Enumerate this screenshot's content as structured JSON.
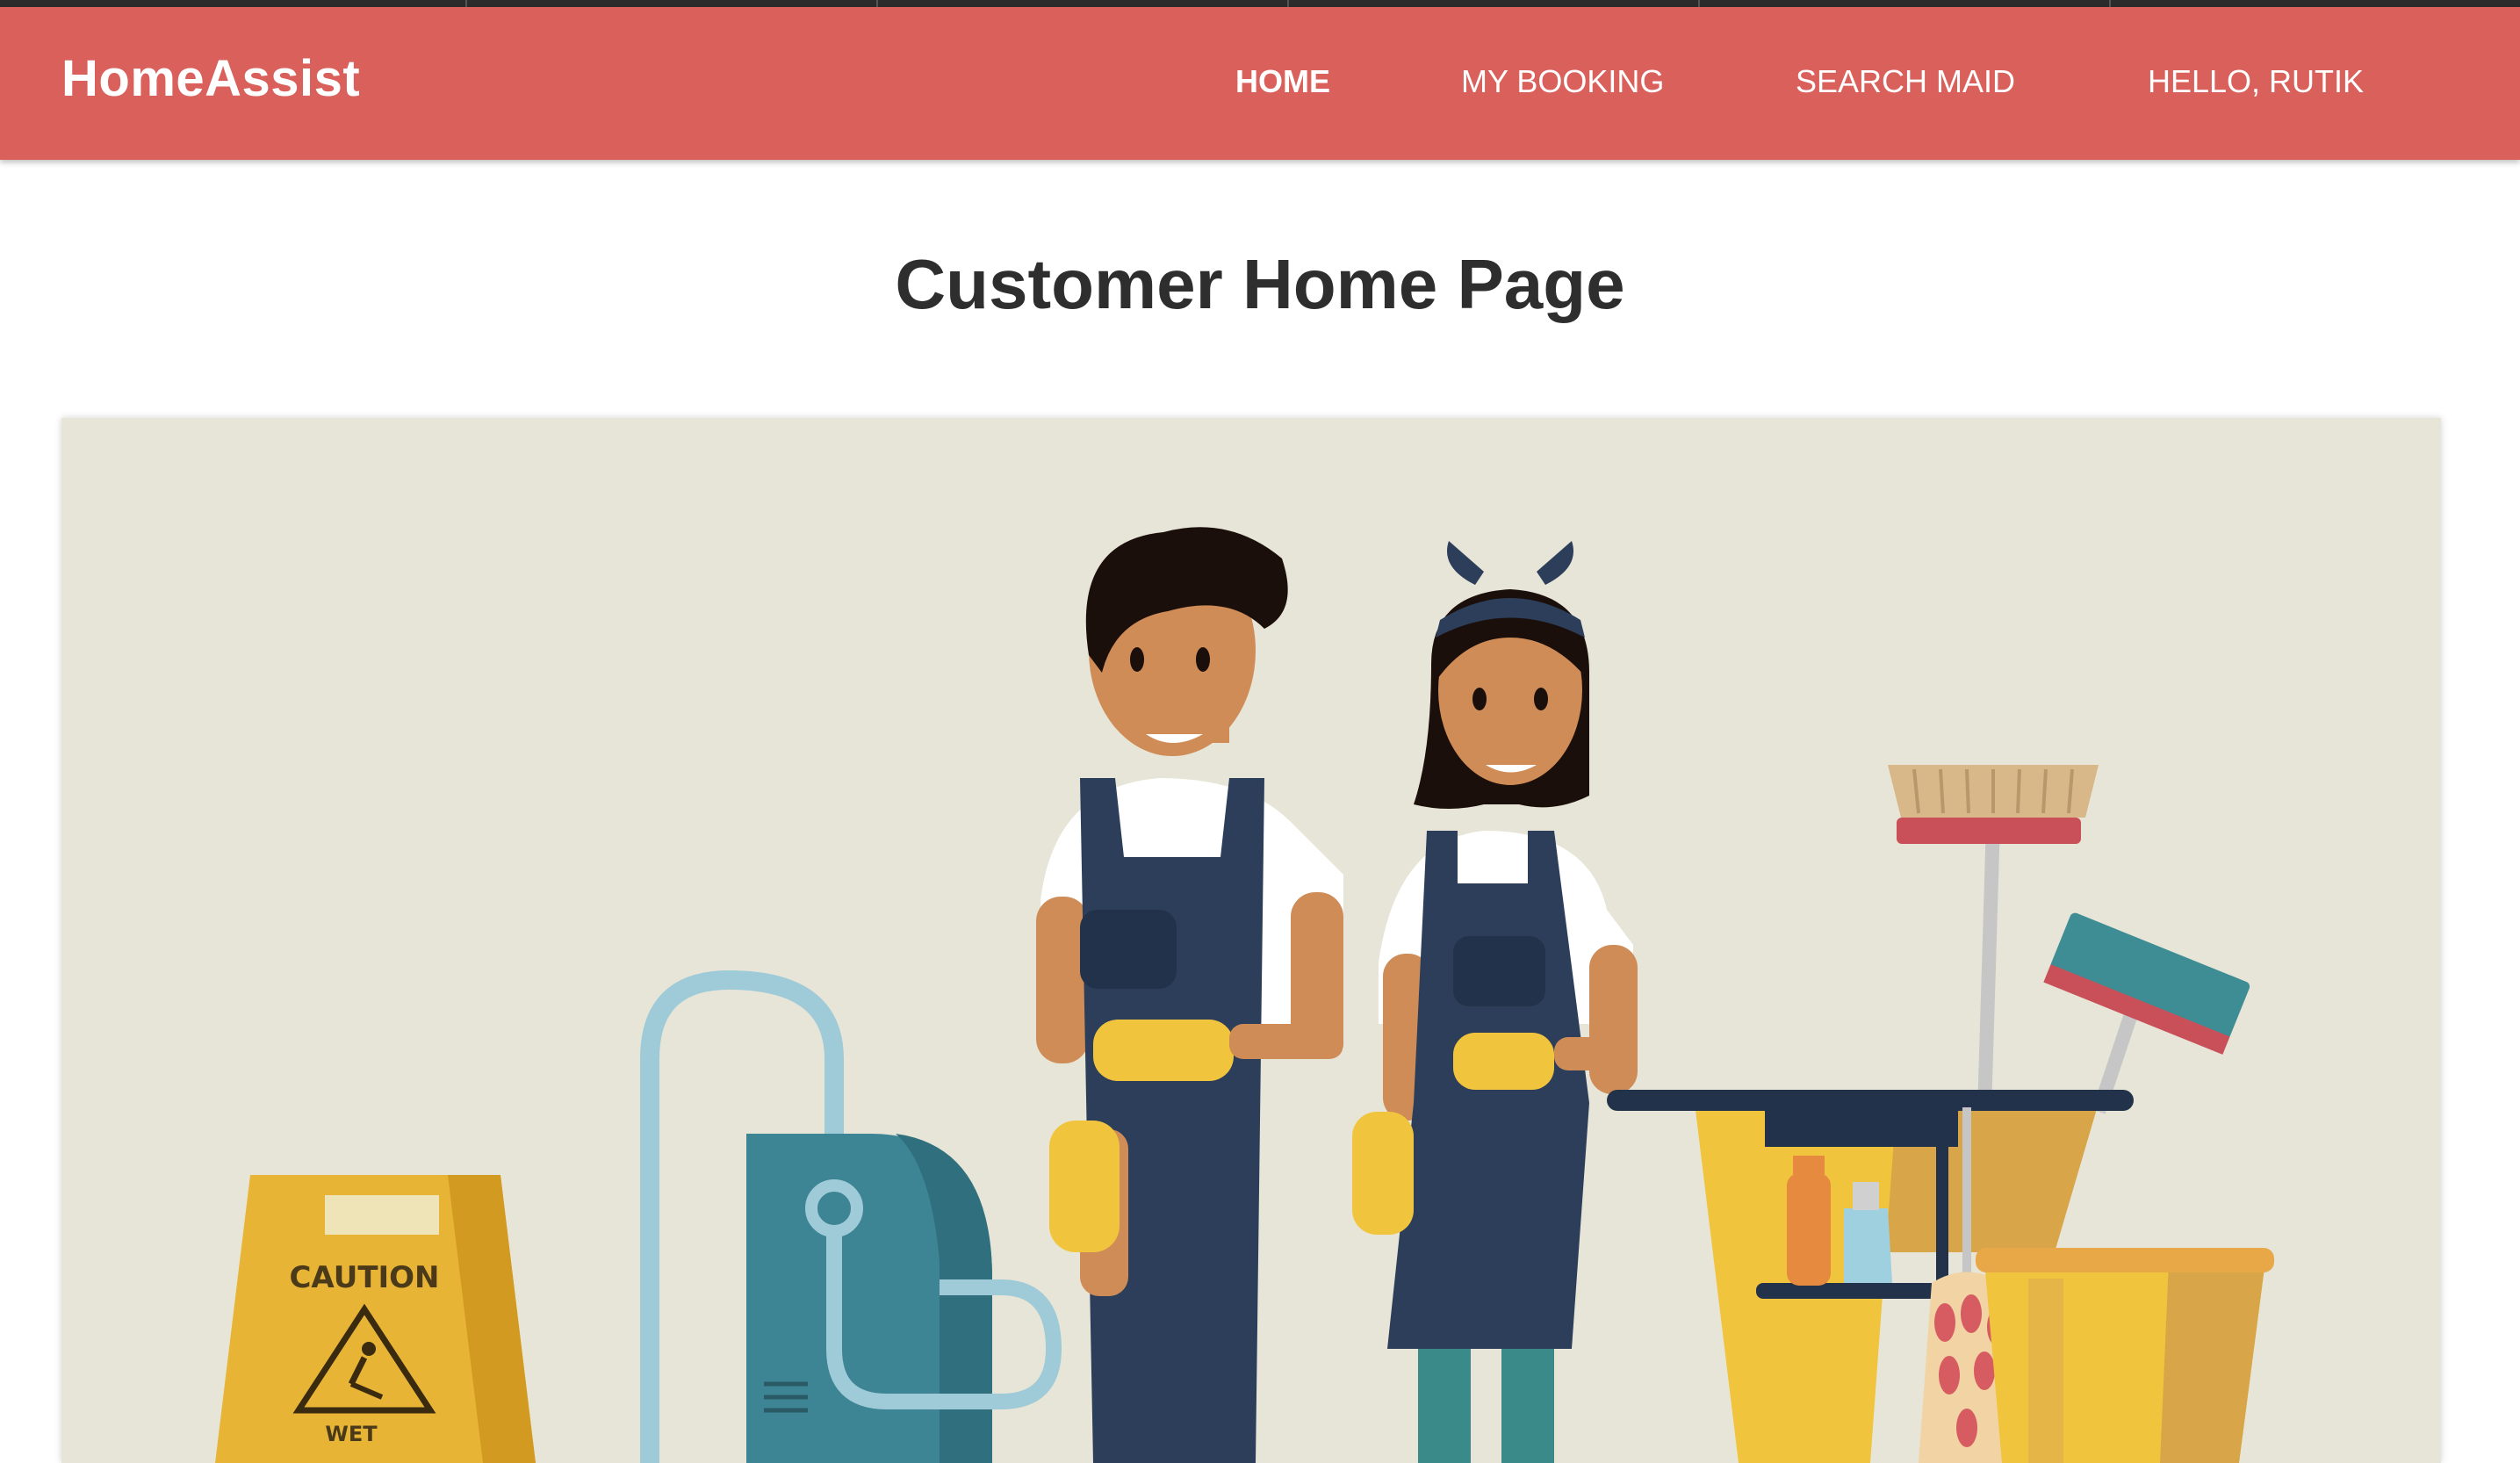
{
  "navbar": {
    "brand": "HomeAssist",
    "links": [
      {
        "label": "HOME",
        "active": true
      },
      {
        "label": "MY BOOKING",
        "active": false
      },
      {
        "label": "SEARCH MAID",
        "active": false
      },
      {
        "label": "HELLO, RUTIK",
        "active": false
      }
    ]
  },
  "main": {
    "title": "Customer Home Page",
    "hero": {
      "sign_text": "CAUTION",
      "sign_subtext": "WET"
    }
  },
  "colors": {
    "navbar_bg": "#d9605b",
    "hero_bg": "#e7e5d7",
    "title": "#2e2e2e"
  }
}
